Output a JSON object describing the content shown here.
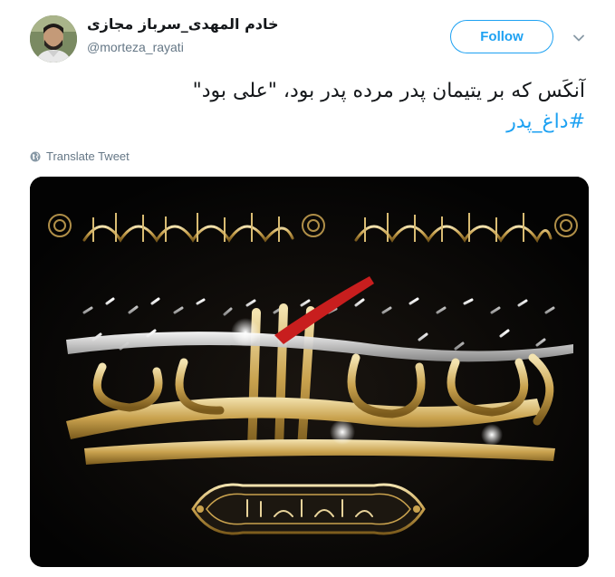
{
  "user": {
    "display_name": "خادم المهدی_سرباز مجازی",
    "handle": "@morteza_rayati"
  },
  "follow_label": "Follow",
  "tweet": {
    "line1": "آنکَس که بر یتیمان پدر مرده پدر بود، \"علی بود\"",
    "hashtag": "#داغ_پدر"
  },
  "translate_label": "Translate Tweet",
  "icons": {
    "caret": "chevron-down-icon",
    "globe": "globe-icon"
  },
  "colors": {
    "accent": "#1da1f2",
    "muted": "#657786",
    "text": "#14171a"
  }
}
